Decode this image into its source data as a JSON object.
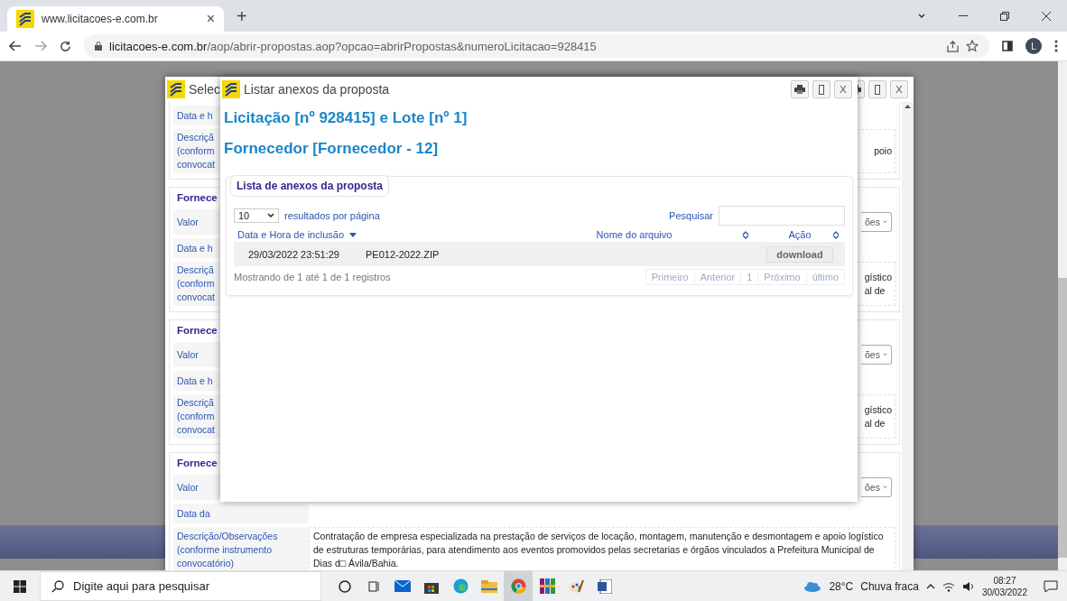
{
  "browser": {
    "tab": {
      "title": "www.licitacoes-e.com.br",
      "close": "×",
      "selected": true
    },
    "new_tab": "+",
    "url_host": "licitacoes-e.com.br",
    "url_path": "/aop/abrir-propostas.aop?opcao=abrirPropostas&numeroLicitacao=928415",
    "profile": "L"
  },
  "back_dialog": {
    "title": "Selec",
    "close_label": "X",
    "sections": [
      {
        "rows": [
          {
            "kind": "text",
            "label": "Data e h"
          },
          {
            "kind": "description",
            "label": "Descriçã\n(conform\nconvocat",
            "value": "poio"
          }
        ]
      },
      {
        "header": "Fornece",
        "rows": [
          {
            "kind": "select",
            "label": "Valor",
            "value": "ões"
          },
          {
            "kind": "text",
            "label": "Data e h"
          },
          {
            "kind": "description",
            "label": "Descriçã\n(conform\nconvocat",
            "value": "gístico\nal de"
          }
        ]
      },
      {
        "header": "Fornece",
        "rows": [
          {
            "kind": "select",
            "label": "Valor",
            "value": "ões"
          },
          {
            "kind": "text",
            "label": "Data e h"
          },
          {
            "kind": "description",
            "label": "Descriçã\n(conform\nconvocat",
            "value": "gístico\nal de"
          }
        ]
      },
      {
        "header": "Fornece",
        "rows": [
          {
            "kind": "select",
            "label": "Valor",
            "value": "ões"
          },
          {
            "kind": "text",
            "label": "Data da"
          },
          {
            "kind": "full",
            "label": "Descrição/Observações\n(conforme instrumento\nconvocatório)",
            "value": "Contratação de empresa especializada na prestação de serviços de locação, montagem, manutenção e desmontagem e apoio logístico de estruturas temporárias, para atendimento aos eventos promovidos pelas secretarias e órgãos vinculados a Prefeitura Municipal de Dias d□ Ávila/Bahia."
          }
        ]
      }
    ]
  },
  "dialog": {
    "title": "Listar anexos da proposta",
    "close_label": "X",
    "heading": "Licitação [nº 928415] e Lote [nº 1]",
    "subheading": "Fornecedor [Fornecedor - 12]",
    "panel": {
      "legend": "Lista de anexos da proposta",
      "page_size": "10",
      "page_size_label": "resultados por página",
      "search_label": "Pesquisar",
      "columns": [
        {
          "label": "Data e Hora de inclusão",
          "sorted": true
        },
        {
          "label": "Nome do arquivo",
          "sorted": false
        },
        {
          "label": "Ação",
          "sorted": false
        }
      ],
      "rows": [
        {
          "date": "29/03/2022 23:51:29",
          "file": "PE012-2022.ZIP",
          "action": "download"
        }
      ],
      "info": "Mostrando de 1 até 1 de 1 registros",
      "pagination": [
        {
          "label": "Primeiro",
          "disabled": true
        },
        {
          "label": "Anterior",
          "disabled": true
        },
        {
          "label": "1",
          "disabled": true
        },
        {
          "label": "Próximo",
          "disabled": true
        },
        {
          "label": "último",
          "disabled": true
        }
      ]
    }
  },
  "taskbar": {
    "search_placeholder": "Digite aqui para pesquisar",
    "temperature": "28°C",
    "weather": "Chuva fraca",
    "time": "08:27",
    "date": "30/03/2022"
  }
}
